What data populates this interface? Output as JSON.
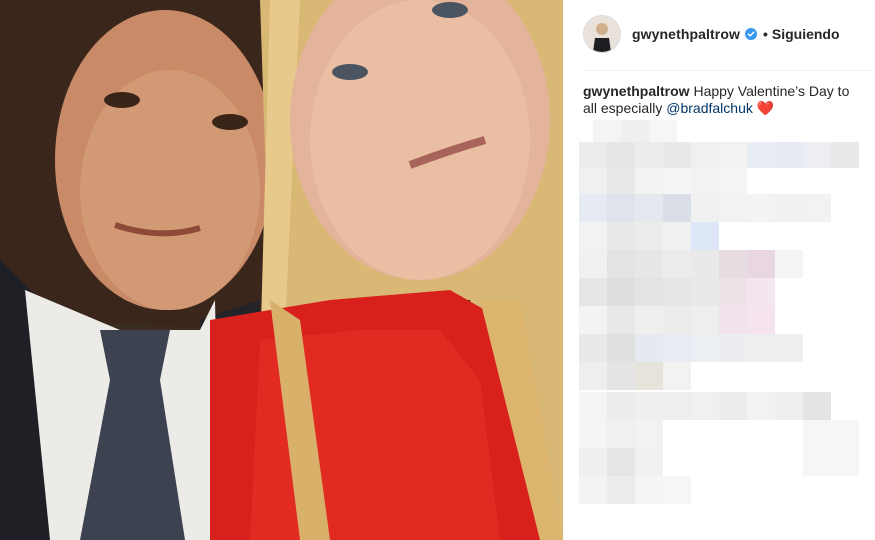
{
  "post": {
    "username": "gwynethpaltrow",
    "separator": "•",
    "follow_status": "Siguiendo",
    "caption": {
      "username": "gwynethpaltrow",
      "text": " Happy Valentine’s Day to all especially ",
      "mention": "@bradfalchuk",
      "emoji": "❤️"
    }
  },
  "colors": {
    "verified_badge": "#3897f0",
    "mention": "#003569",
    "heart": "#ed1c2e",
    "dress": "#d8201c"
  },
  "icons": [
    "verified-badge-icon"
  ]
}
